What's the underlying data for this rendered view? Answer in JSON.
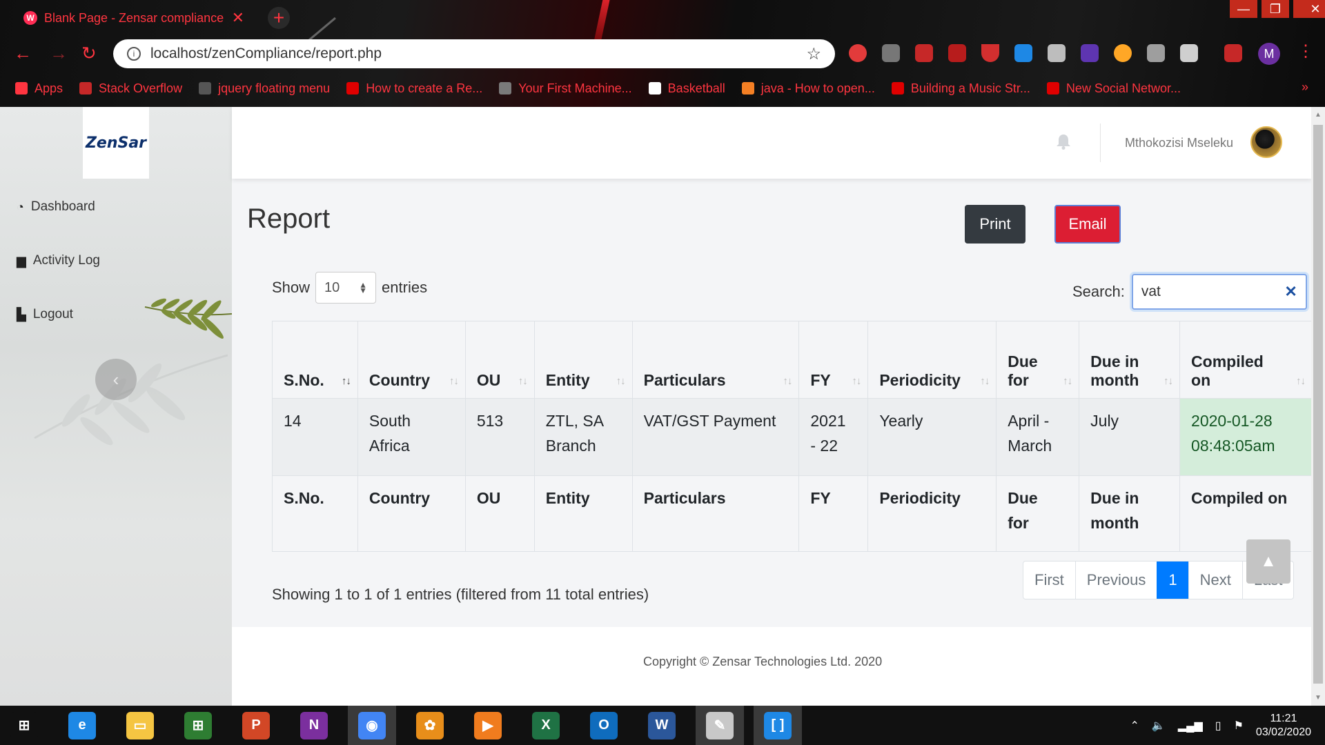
{
  "browser": {
    "tab_title": "Blank Page - Zensar compliance",
    "tab_close": "✕",
    "new_tab": "+",
    "window_controls": [
      "—",
      "❐",
      "✕"
    ],
    "nav": {
      "back": "←",
      "forward": "→",
      "reload": "↻"
    },
    "url": "localhost/zenCompliance/report.php",
    "profile_initial": "M",
    "bookmarks": [
      {
        "label": "Apps",
        "color": "#ff3540"
      },
      {
        "label": "Stack Overflow",
        "color": "#c62828"
      },
      {
        "label": "jquery floating menu",
        "color": "#555555"
      },
      {
        "label": "How to create a Re...",
        "color": "#e00000"
      },
      {
        "label": "Your First Machine...",
        "color": "#7a7a7a"
      },
      {
        "label": "Basketball",
        "color": "#ffffff"
      },
      {
        "label": "java - How to open...",
        "color": "#f48024"
      },
      {
        "label": "Building a Music Str...",
        "color": "#e00000"
      },
      {
        "label": "New Social Networ...",
        "color": "#e00000"
      }
    ],
    "bookmarks_overflow": "»"
  },
  "sidebar": {
    "logo_text": "ZenSar",
    "items": [
      {
        "label": "Dashboard",
        "icon": "tachometer-icon"
      },
      {
        "label": "Activity Log",
        "icon": "book-icon"
      },
      {
        "label": "Logout",
        "icon": "door-icon"
      }
    ],
    "collapse_glyph": "‹"
  },
  "topbar": {
    "user_name": "Mthokozisi Mseleku"
  },
  "report": {
    "title": "Report",
    "print_label": "Print",
    "email_label": "Email",
    "show_label": "Show",
    "entries_label": "entries",
    "page_size": "10",
    "search_label": "Search:",
    "search_value": "vat",
    "search_clear": "✕",
    "columns": [
      "S.No.",
      "Country",
      "OU",
      "Entity",
      "Particulars",
      "FY",
      "Periodicity",
      "Due for",
      "Due in month",
      "Compiled on"
    ],
    "header_lines": [
      [
        "S.No."
      ],
      [
        "Country"
      ],
      [
        "OU"
      ],
      [
        "Entity"
      ],
      [
        "Particulars"
      ],
      [
        "FY"
      ],
      [
        "Periodicity"
      ],
      [
        "Due",
        "for"
      ],
      [
        "Due in",
        "month"
      ],
      [
        "Compiled",
        "on"
      ]
    ],
    "footer_lines": [
      [
        "S.No."
      ],
      [
        "Country"
      ],
      [
        "OU"
      ],
      [
        "Entity"
      ],
      [
        "Particulars"
      ],
      [
        "FY"
      ],
      [
        "Periodicity"
      ],
      [
        "Due",
        "for"
      ],
      [
        "Due in",
        "month"
      ],
      [
        "Compiled on"
      ]
    ],
    "rows": [
      [
        [
          "14"
        ],
        [
          "South",
          "Africa"
        ],
        [
          "513"
        ],
        [
          "ZTL, SA",
          "Branch"
        ],
        [
          "VAT/GST Payment"
        ],
        [
          "2021",
          "- 22"
        ],
        [
          "Yearly"
        ],
        [
          "April -",
          "March"
        ],
        [
          "July"
        ],
        [
          "2020-01-28",
          "08:48:05am"
        ]
      ]
    ],
    "sorted_column": 0,
    "info": "Showing 1 to 1 of 1 entries (filtered from 11 total entries)",
    "pagination": [
      "First",
      "Previous",
      "1",
      "Next",
      "Last"
    ],
    "current_page": "1"
  },
  "footer": {
    "copyright": "Copyright © Zensar Technologies Ltd. 2020",
    "to_top": "▲"
  },
  "taskbar": {
    "apps": [
      {
        "name": "start-button",
        "label": "⊞",
        "color": "#111111"
      },
      {
        "name": "internet-explorer-icon",
        "label": "e",
        "color": "#1e88e5"
      },
      {
        "name": "file-explorer-icon",
        "label": "▭",
        "color": "#f5c542"
      },
      {
        "name": "store-icon",
        "label": "⊞",
        "color": "#2e7d32"
      },
      {
        "name": "powerpoint-icon",
        "label": "P",
        "color": "#d24726"
      },
      {
        "name": "onenote-icon",
        "label": "N",
        "color": "#7b2f9e"
      },
      {
        "name": "chrome-icon",
        "label": "◉",
        "color": "#4285f4"
      },
      {
        "name": "fl-studio-icon",
        "label": "✿",
        "color": "#e88e1a"
      },
      {
        "name": "media-player-icon",
        "label": "▶",
        "color": "#f07c1e"
      },
      {
        "name": "excel-icon",
        "label": "X",
        "color": "#1f7244"
      },
      {
        "name": "outlook-icon",
        "label": "O",
        "color": "#0f6cbd"
      },
      {
        "name": "word-icon",
        "label": "W",
        "color": "#2b579a"
      },
      {
        "name": "paint-icon",
        "label": "✎",
        "color": "#c8c8c8"
      },
      {
        "name": "brackets-icon",
        "label": "[ ]",
        "color": "#1e88e5"
      }
    ],
    "time": "11:21",
    "date": "03/02/2020"
  }
}
